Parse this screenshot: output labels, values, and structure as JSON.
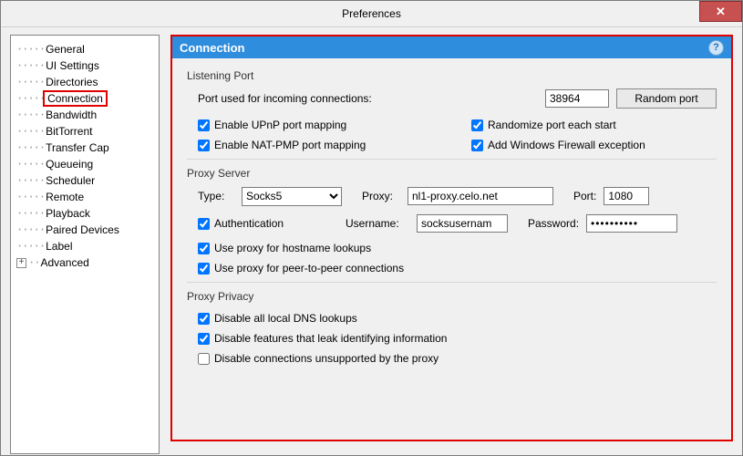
{
  "window": {
    "title": "Preferences",
    "close_glyph": "✕"
  },
  "tree": {
    "items": [
      "General",
      "UI Settings",
      "Directories",
      "Connection",
      "Bandwidth",
      "BitTorrent",
      "Transfer Cap",
      "Queueing",
      "Scheduler",
      "Remote",
      "Playback",
      "Paired Devices",
      "Label"
    ],
    "advanced": "Advanced",
    "selected_index": 3
  },
  "panel": {
    "title": "Connection",
    "help_glyph": "?",
    "listening": {
      "group": "Listening Port",
      "port_label": "Port used for incoming connections:",
      "port_value": "38964",
      "random_btn": "Random port",
      "upnp": "Enable UPnP port mapping",
      "natpmp": "Enable NAT-PMP port mapping",
      "randomize": "Randomize port each start",
      "firewall": "Add Windows Firewall exception"
    },
    "proxy": {
      "group": "Proxy Server",
      "type_label": "Type:",
      "type_value": "Socks5",
      "proxy_label": "Proxy:",
      "proxy_value": "nl1-proxy.celo.net",
      "port_label": "Port:",
      "port_value": "1080",
      "auth": "Authentication",
      "user_label": "Username:",
      "user_value": "socksusernam",
      "pass_label": "Password:",
      "pass_value": "••••••••••",
      "hostname": "Use proxy for hostname lookups",
      "p2p": "Use proxy for peer-to-peer connections"
    },
    "privacy": {
      "group": "Proxy Privacy",
      "dns": "Disable all local DNS lookups",
      "leak": "Disable features that leak identifying information",
      "unsupported": "Disable connections unsupported by the proxy"
    }
  }
}
